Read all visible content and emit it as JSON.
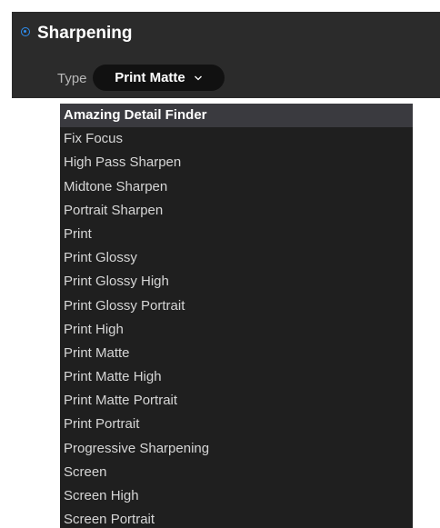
{
  "panel": {
    "title": "Sharpening",
    "type_label": "Type",
    "type_value": "Print Matte",
    "accent_color": "#2e8ef0",
    "icons": {
      "power": "power-toggle-icon",
      "dropdown": "chevron-down-icon"
    }
  },
  "dropdown": {
    "selected_index": 0,
    "items": [
      "Amazing Detail Finder",
      "Fix Focus",
      "High Pass Sharpen",
      "Midtone Sharpen",
      "Portrait Sharpen",
      "Print",
      "Print Glossy",
      "Print Glossy High",
      "Print Glossy Portrait",
      "Print High",
      "Print Matte",
      "Print Matte High",
      "Print Matte Portrait",
      "Print Portrait",
      "Progressive Sharpening",
      "Screen",
      "Screen High",
      "Screen Portrait"
    ]
  }
}
